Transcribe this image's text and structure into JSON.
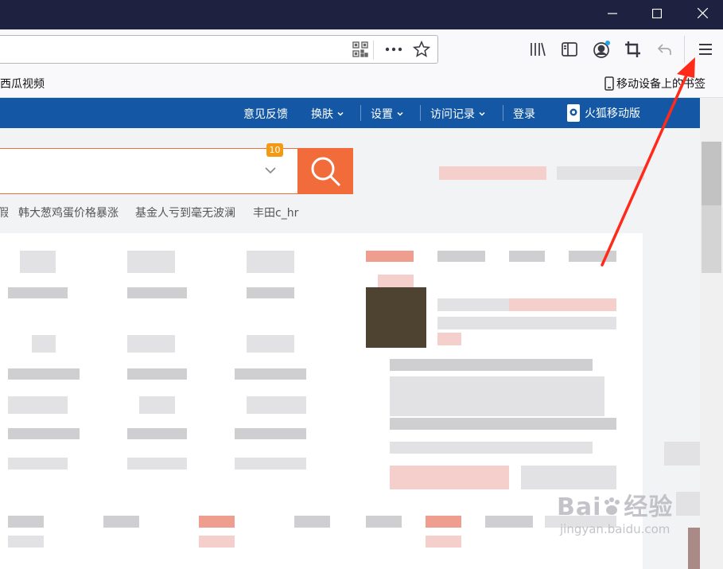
{
  "browser": {
    "menu_icon": "hamburger-menu-icon",
    "toolbar_icons": [
      "qr-code-icon",
      "more-dots-icon",
      "star-icon",
      "library-icon",
      "sidebar-icon",
      "account-icon",
      "crop-icon",
      "undo-icon"
    ],
    "accent_color": "#1458a5",
    "titlebar_color": "#1f2140"
  },
  "bookmarks": {
    "left_label": "西瓜视频",
    "right_label": "移动设备上的书签"
  },
  "site_nav": {
    "feedback": "意见反馈",
    "skin": "换肤",
    "settings": "设置",
    "history": "访问记录",
    "login": "登录",
    "mobile": "火狐移动版"
  },
  "search": {
    "badge": "10",
    "hot_words": [
      "假",
      "韩大葱鸡蛋价格暴涨",
      "基金人亏到毫无波澜",
      "丰田c_hr"
    ],
    "button_color": "#f26b3a"
  },
  "watermark": {
    "main": "Bai",
    "main2": "经验",
    "sub": "jingyan.baidu.com"
  }
}
